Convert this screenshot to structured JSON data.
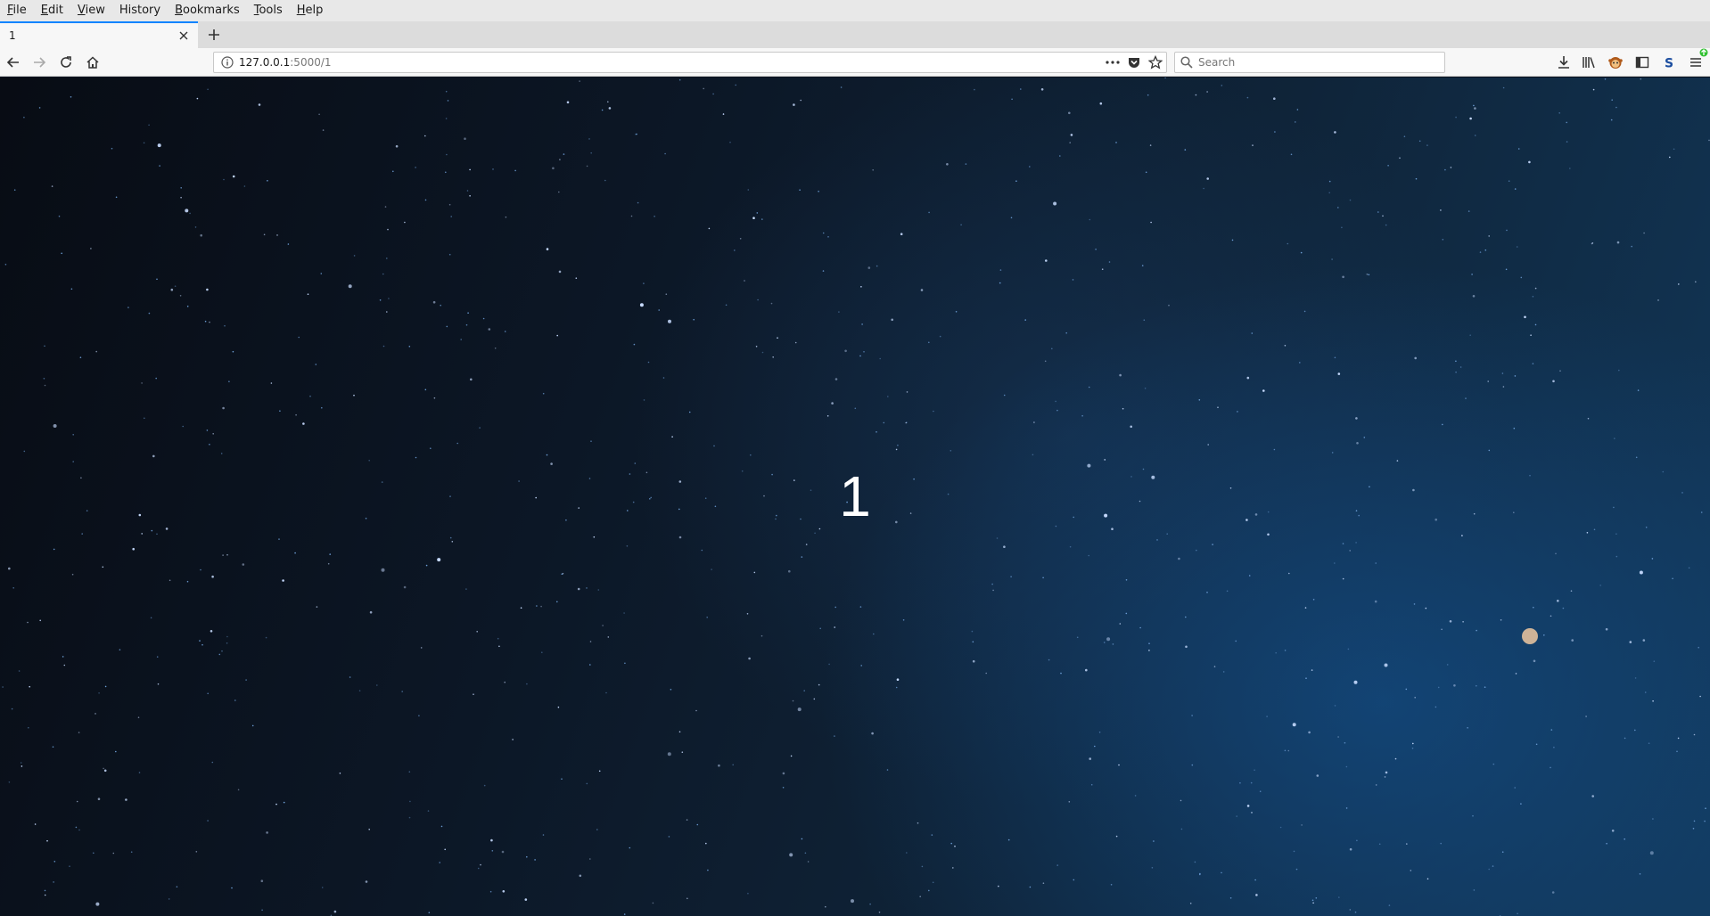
{
  "menubar": {
    "items": [
      {
        "first": "F",
        "rest": "ile"
      },
      {
        "first": "E",
        "rest": "dit"
      },
      {
        "first": "V",
        "rest": "iew"
      },
      {
        "first": "",
        "rest": "History",
        "underline": "H"
      },
      {
        "first": "B",
        "rest": "ookmarks"
      },
      {
        "first": "T",
        "rest": "ools"
      },
      {
        "first": "H",
        "rest": "elp"
      }
    ]
  },
  "tab": {
    "title": "1"
  },
  "url": {
    "host": "127.0.0.1",
    "path": ":5000/1"
  },
  "search": {
    "placeholder": "Search"
  },
  "page": {
    "number": "1"
  },
  "colors": {
    "accent": "#0a84ff",
    "page_bg": "#0c1726"
  }
}
